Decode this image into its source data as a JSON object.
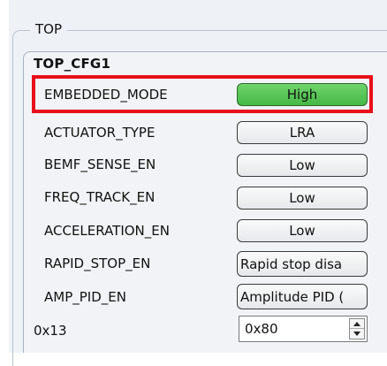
{
  "group": {
    "title": "TOP"
  },
  "config": {
    "title": "TOP_CFG1",
    "rows": [
      {
        "label": "EMBEDDED_MODE",
        "value": "High"
      },
      {
        "label": "ACTUATOR_TYPE",
        "value": "LRA"
      },
      {
        "label": "BEMF_SENSE_EN",
        "value": "Low"
      },
      {
        "label": "FREQ_TRACK_EN",
        "value": "Low"
      },
      {
        "label": "ACCELERATION_EN",
        "value": "Low"
      },
      {
        "label": "RAPID_STOP_EN",
        "value": "Rapid stop disa"
      },
      {
        "label": "AMP_PID_EN",
        "value": "Amplitude PID ("
      }
    ],
    "register": {
      "address": "0x13",
      "value": "0x80"
    }
  },
  "colors": {
    "highlight_border": "#e8101a",
    "active_button": "#55c255",
    "panel_background": "#f1f3f6"
  }
}
